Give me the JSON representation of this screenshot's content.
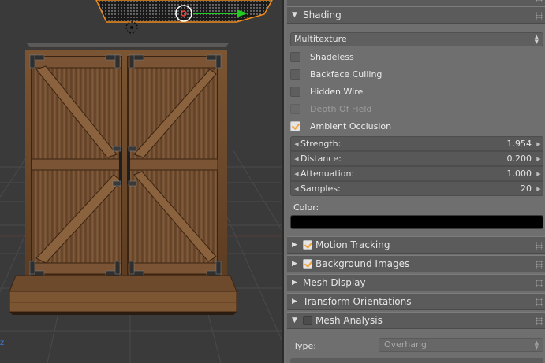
{
  "viewport": {
    "axis_label": "z"
  },
  "shading": {
    "title": "Shading",
    "mode": "Multitexture",
    "options": [
      {
        "label": "Shadeless",
        "checked": false,
        "enabled": true
      },
      {
        "label": "Backface Culling",
        "checked": false,
        "enabled": true
      },
      {
        "label": "Hidden Wire",
        "checked": false,
        "enabled": true
      },
      {
        "label": "Depth Of Field",
        "checked": false,
        "enabled": false
      },
      {
        "label": "Ambient Occlusion",
        "checked": true,
        "enabled": true
      }
    ],
    "ao": {
      "strength": {
        "label": "Strength:",
        "value": "1.954"
      },
      "distance": {
        "label": "Distance:",
        "value": "0.200"
      },
      "attenuation": {
        "label": "Attenuation:",
        "value": "1.000"
      },
      "samples": {
        "label": "Samples:",
        "value": "20"
      },
      "color_label": "Color:",
      "color": "#000000"
    }
  },
  "panels": {
    "motion_tracking": {
      "label": "Motion Tracking",
      "checked": true
    },
    "background_images": {
      "label": "Background Images",
      "checked": true
    },
    "mesh_display": {
      "label": "Mesh Display"
    },
    "transform_orientations": {
      "label": "Transform Orientations"
    },
    "mesh_analysis": {
      "label": "Mesh Analysis",
      "checked": false
    }
  },
  "mesh_analysis": {
    "type_label": "Type:",
    "type_value": "Overhang"
  },
  "colors": {
    "accent_check": "#f0a23a",
    "transform_arrow": "#22cc22"
  }
}
